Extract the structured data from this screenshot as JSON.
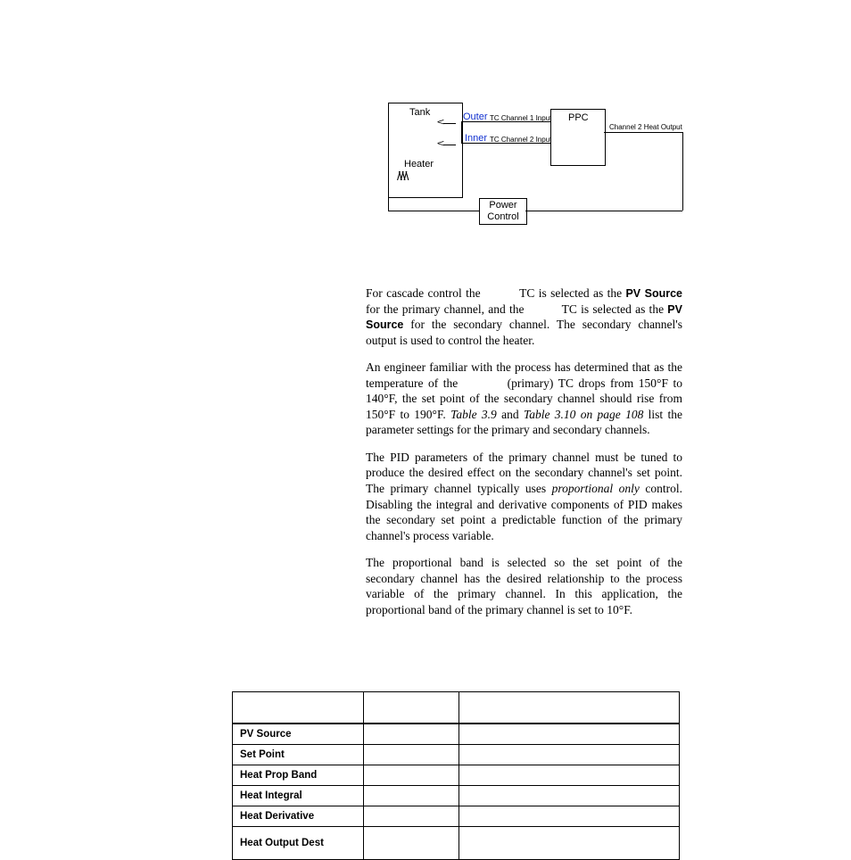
{
  "diagram": {
    "tank": "Tank",
    "heater": "Heater",
    "outer": "Outer",
    "inner": "Inner",
    "tc1": "TC Channel 1 Input",
    "tc2": "TC Channel 2 Input",
    "ppc": "PPC",
    "heat_out": "Channel 2 Heat Output",
    "power": "Power Control"
  },
  "para": {
    "p1a": "For cascade control the ",
    "p1b": " TC is selected as the ",
    "p1_pv": "PV Source",
    "p1c": " for the primary channel, and the ",
    "p1d": " TC is selected as the ",
    "p1_pv2": "PV Source",
    "p1e": " for the secondary channel. The secondary channel's output is used to control the heater.",
    "p2a": "An engineer familiar with the process has determined that as the temperature of the ",
    "p2b": " (primary) TC drops from 150°F to 140°F, the set point of the secondary channel should rise from 150°F to 190°F. ",
    "p2_t1": "Table 3.9",
    "p2c": " and ",
    "p2_t2": "Table 3.10 on page 108",
    "p2d": " list the parameter settings for the primary and secondary channels.",
    "p3a": "The PID parameters of the primary channel must be tuned to produce the desired effect on the secondary channel's set point. The primary channel typically uses ",
    "p3_po": "proportional only",
    "p3b": " control. Disabling the integral and derivative components of PID makes the secondary set point a predictable function of the primary channel's process variable.",
    "p4": "The proportional band is selected so the set point of the secondary channel has the desired relationship to the process variable of the primary channel. In this application, the proportional band of the primary channel is set to 10°F."
  },
  "table": {
    "headers": [
      "",
      "",
      ""
    ],
    "rows": [
      {
        "param": "PV Source",
        "v1": "",
        "v2": ""
      },
      {
        "param": "Set Point",
        "v1": "",
        "v2": ""
      },
      {
        "param": "Heat Prop Band",
        "v1": "",
        "v2": ""
      },
      {
        "param": "Heat Integral",
        "v1": "",
        "v2": ""
      },
      {
        "param": "Heat Derivative",
        "v1": "",
        "v2": ""
      },
      {
        "param": "Heat Output Dest",
        "v1": "",
        "v2": ""
      }
    ]
  }
}
